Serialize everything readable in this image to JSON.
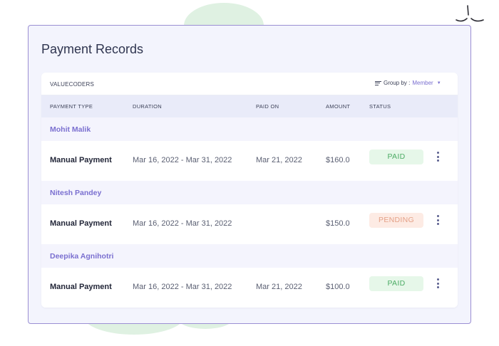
{
  "card": {
    "title": "Payment Records",
    "organization": "VALUECODERS",
    "group_by": {
      "label": "Group by :",
      "value": "Member"
    }
  },
  "columns": [
    "PAYMENT TYPE",
    "DURATION",
    "PAID ON",
    "AMOUNT",
    "STATUS"
  ],
  "groups": [
    {
      "member": "Mohit Malik",
      "payment_type": "Manual Payment",
      "duration": "Mar 16, 2022 - Mar 31, 2022",
      "paid_on": "Mar 21, 2022",
      "amount": "$160.0",
      "status": "PAID"
    },
    {
      "member": "Nitesh Pandey",
      "payment_type": "Manual Payment",
      "duration": "Mar 16, 2022 - Mar 31, 2022",
      "paid_on": "",
      "amount": "$150.0",
      "status": "PENDING"
    },
    {
      "member": "Deepika Agnihotri",
      "payment_type": "Manual Payment",
      "duration": "Mar 16, 2022 - Mar 31, 2022",
      "paid_on": "Mar 21, 2022",
      "amount": "$100.0",
      "status": "PAID"
    }
  ],
  "icons": {
    "group_by": "lines-filter-icon",
    "dropdown": "caret-down-icon",
    "row_menu": "kebab-menu-icon",
    "decoration": "sparkle-icon"
  },
  "colors": {
    "accent": "#7a6fd0",
    "paid_text": "#4dac66",
    "paid_bg": "#e6f7e9",
    "pending_text": "#e4a187",
    "pending_bg": "#fdebe4",
    "card_border": "#9b8fd3"
  }
}
